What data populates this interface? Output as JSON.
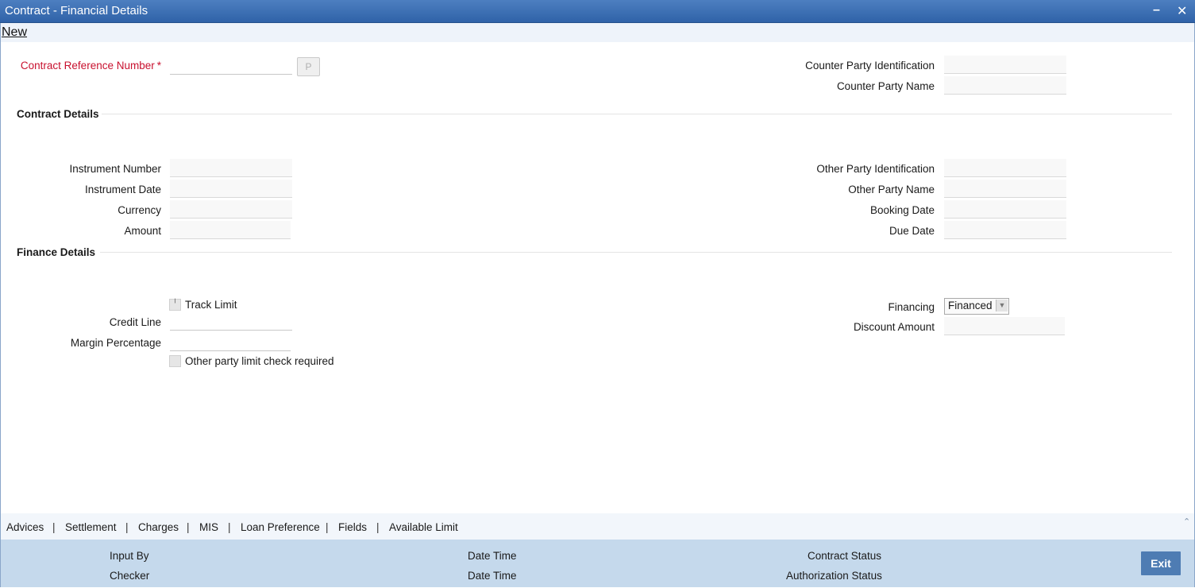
{
  "window": {
    "title": "Contract - Financial Details",
    "minimize_icon": "minimize-icon",
    "close_icon": "close-icon"
  },
  "menu": {
    "new_label": "New"
  },
  "contract": {
    "ref_label": "Contract Reference Number",
    "required_mark": "*",
    "ref_value": "",
    "p_button": "P",
    "counter_party_id_label": "Counter Party Identification",
    "counter_party_id_value": "",
    "counter_party_name_label": "Counter Party Name",
    "counter_party_name_value": ""
  },
  "contract_details": {
    "heading": "Contract Details",
    "instrument_number_label": "Instrument Number",
    "instrument_number_value": "",
    "instrument_date_label": "Instrument Date",
    "instrument_date_value": "",
    "currency_label": "Currency",
    "currency_value": "",
    "amount_label": "Amount",
    "amount_value": "",
    "other_party_id_label": "Other Party Identification",
    "other_party_id_value": "",
    "other_party_name_label": "Other Party Name",
    "other_party_name_value": "",
    "booking_date_label": "Booking Date",
    "booking_date_value": "",
    "due_date_label": "Due Date",
    "due_date_value": ""
  },
  "finance_details": {
    "heading": "Finance Details",
    "track_limit_label": "Track Limit",
    "track_limit_checked": false,
    "credit_line_label": "Credit Line",
    "credit_line_value": "",
    "margin_percentage_label": "Margin Percentage",
    "margin_percentage_value": "",
    "other_party_limit_label": "Other party limit check required",
    "other_party_limit_checked": false,
    "financing_label": "Financing",
    "financing_value": "Financed",
    "discount_amount_label": "Discount Amount",
    "discount_amount_value": ""
  },
  "tabs": [
    "Advices",
    "Settlement",
    "Charges",
    "MIS",
    "Loan Preference",
    "Fields",
    "Available Limit"
  ],
  "tab_separator": "|",
  "footer": {
    "input_by_label": "Input By",
    "checker_label": "Checker",
    "date_time_label_1": "Date Time",
    "date_time_label_2": "Date Time",
    "contract_status_label": "Contract Status",
    "authorization_status_label": "Authorization Status",
    "exit_label": "Exit"
  }
}
